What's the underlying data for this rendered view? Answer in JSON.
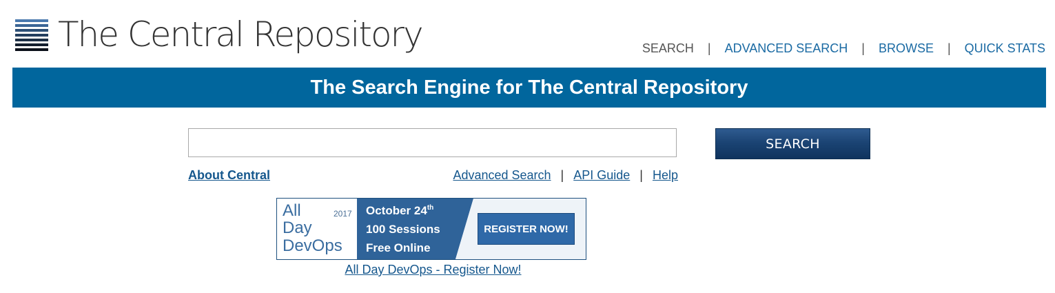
{
  "header": {
    "logo_text": "The Central Repository",
    "nav": [
      {
        "label": "SEARCH"
      },
      {
        "label": "ADVANCED SEARCH"
      },
      {
        "label": "BROWSE"
      },
      {
        "label": "QUICK STATS"
      }
    ],
    "separator": "|"
  },
  "banner": {
    "title": "The Search Engine for The Central Repository"
  },
  "search": {
    "input_value": "",
    "placeholder": "",
    "button_label": "SEARCH"
  },
  "links": {
    "about": "About Central",
    "right": [
      {
        "label": "Advanced Search"
      },
      {
        "label": "API Guide"
      },
      {
        "label": "Help"
      }
    ],
    "separator": "|"
  },
  "ad": {
    "logo_line1": "All",
    "logo_line2": "Day",
    "logo_line3": "DevOps",
    "year": "2017",
    "line1": "October 24",
    "line1_suffix": "th",
    "line2": "100 Sessions",
    "line3": "Free Online",
    "register": "REGISTER NOW!",
    "caption": "All Day DevOps - Register Now!"
  },
  "colors": {
    "banner": "#01669d",
    "link": "#15578d",
    "nav_link": "#1a6aa3",
    "button": "#1b4474"
  }
}
